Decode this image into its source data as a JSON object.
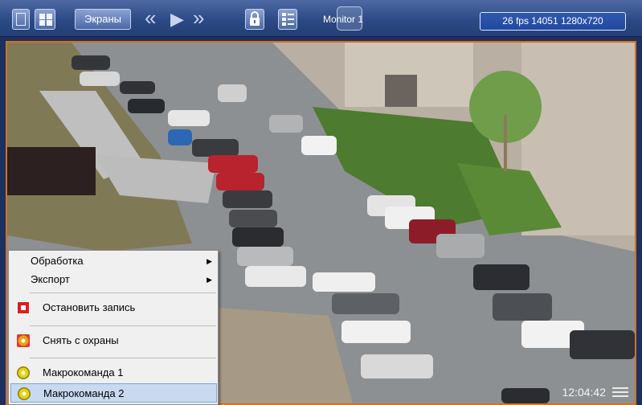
{
  "toolbar": {
    "screens_label": "Экраны",
    "monitor_label": "Monitor 1",
    "status_text": "26 fps  14051 1280x720"
  },
  "video": {
    "timestamp": "12:04:42"
  },
  "context_menu": {
    "items": [
      {
        "label": "Обработка"
      },
      {
        "label": "Экспорт"
      },
      {
        "label": "Остановить запись"
      },
      {
        "label": "Снять с охраны"
      },
      {
        "label": "Макрокоманда 1"
      },
      {
        "label": "Макрокоманда 2"
      }
    ]
  },
  "colors": {
    "toolbar_blue": "#2c4a86",
    "video_frame": "#d7711f",
    "menu_highlight": "#c8d9f0"
  }
}
